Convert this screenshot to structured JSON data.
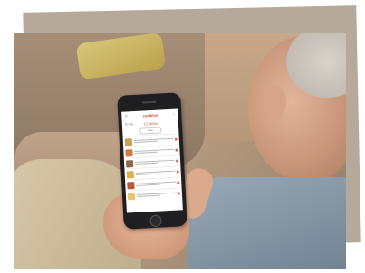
{
  "scene": {
    "description_elements": [
      "photo-frame",
      "person",
      "smartphone"
    ]
  },
  "phone": {
    "brand_logo": "coolblue",
    "screen_title": "12 ideas",
    "back_label": "Terug",
    "filter_label": "Filter",
    "item_count": 6
  },
  "colors": {
    "accent": "#d2482a",
    "frame": "#b5a99c"
  }
}
